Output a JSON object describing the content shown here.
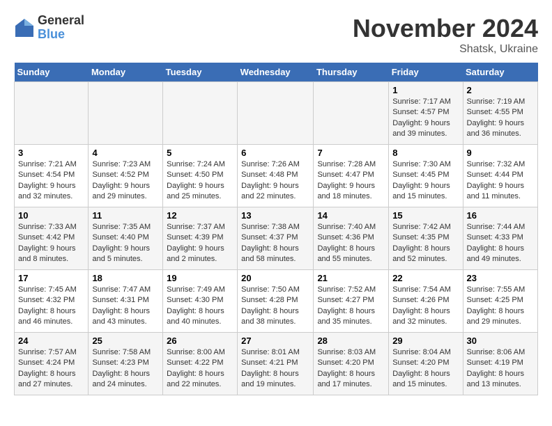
{
  "header": {
    "logo_general": "General",
    "logo_blue": "Blue",
    "month_title": "November 2024",
    "location": "Shatsk, Ukraine"
  },
  "weekdays": [
    "Sunday",
    "Monday",
    "Tuesday",
    "Wednesday",
    "Thursday",
    "Friday",
    "Saturday"
  ],
  "weeks": [
    [
      {
        "day": "",
        "info": ""
      },
      {
        "day": "",
        "info": ""
      },
      {
        "day": "",
        "info": ""
      },
      {
        "day": "",
        "info": ""
      },
      {
        "day": "",
        "info": ""
      },
      {
        "day": "1",
        "info": "Sunrise: 7:17 AM\nSunset: 4:57 PM\nDaylight: 9 hours and 39 minutes."
      },
      {
        "day": "2",
        "info": "Sunrise: 7:19 AM\nSunset: 4:55 PM\nDaylight: 9 hours and 36 minutes."
      }
    ],
    [
      {
        "day": "3",
        "info": "Sunrise: 7:21 AM\nSunset: 4:54 PM\nDaylight: 9 hours and 32 minutes."
      },
      {
        "day": "4",
        "info": "Sunrise: 7:23 AM\nSunset: 4:52 PM\nDaylight: 9 hours and 29 minutes."
      },
      {
        "day": "5",
        "info": "Sunrise: 7:24 AM\nSunset: 4:50 PM\nDaylight: 9 hours and 25 minutes."
      },
      {
        "day": "6",
        "info": "Sunrise: 7:26 AM\nSunset: 4:48 PM\nDaylight: 9 hours and 22 minutes."
      },
      {
        "day": "7",
        "info": "Sunrise: 7:28 AM\nSunset: 4:47 PM\nDaylight: 9 hours and 18 minutes."
      },
      {
        "day": "8",
        "info": "Sunrise: 7:30 AM\nSunset: 4:45 PM\nDaylight: 9 hours and 15 minutes."
      },
      {
        "day": "9",
        "info": "Sunrise: 7:32 AM\nSunset: 4:44 PM\nDaylight: 9 hours and 11 minutes."
      }
    ],
    [
      {
        "day": "10",
        "info": "Sunrise: 7:33 AM\nSunset: 4:42 PM\nDaylight: 9 hours and 8 minutes."
      },
      {
        "day": "11",
        "info": "Sunrise: 7:35 AM\nSunset: 4:40 PM\nDaylight: 9 hours and 5 minutes."
      },
      {
        "day": "12",
        "info": "Sunrise: 7:37 AM\nSunset: 4:39 PM\nDaylight: 9 hours and 2 minutes."
      },
      {
        "day": "13",
        "info": "Sunrise: 7:38 AM\nSunset: 4:37 PM\nDaylight: 8 hours and 58 minutes."
      },
      {
        "day": "14",
        "info": "Sunrise: 7:40 AM\nSunset: 4:36 PM\nDaylight: 8 hours and 55 minutes."
      },
      {
        "day": "15",
        "info": "Sunrise: 7:42 AM\nSunset: 4:35 PM\nDaylight: 8 hours and 52 minutes."
      },
      {
        "day": "16",
        "info": "Sunrise: 7:44 AM\nSunset: 4:33 PM\nDaylight: 8 hours and 49 minutes."
      }
    ],
    [
      {
        "day": "17",
        "info": "Sunrise: 7:45 AM\nSunset: 4:32 PM\nDaylight: 8 hours and 46 minutes."
      },
      {
        "day": "18",
        "info": "Sunrise: 7:47 AM\nSunset: 4:31 PM\nDaylight: 8 hours and 43 minutes."
      },
      {
        "day": "19",
        "info": "Sunrise: 7:49 AM\nSunset: 4:30 PM\nDaylight: 8 hours and 40 minutes."
      },
      {
        "day": "20",
        "info": "Sunrise: 7:50 AM\nSunset: 4:28 PM\nDaylight: 8 hours and 38 minutes."
      },
      {
        "day": "21",
        "info": "Sunrise: 7:52 AM\nSunset: 4:27 PM\nDaylight: 8 hours and 35 minutes."
      },
      {
        "day": "22",
        "info": "Sunrise: 7:54 AM\nSunset: 4:26 PM\nDaylight: 8 hours and 32 minutes."
      },
      {
        "day": "23",
        "info": "Sunrise: 7:55 AM\nSunset: 4:25 PM\nDaylight: 8 hours and 29 minutes."
      }
    ],
    [
      {
        "day": "24",
        "info": "Sunrise: 7:57 AM\nSunset: 4:24 PM\nDaylight: 8 hours and 27 minutes."
      },
      {
        "day": "25",
        "info": "Sunrise: 7:58 AM\nSunset: 4:23 PM\nDaylight: 8 hours and 24 minutes."
      },
      {
        "day": "26",
        "info": "Sunrise: 8:00 AM\nSunset: 4:22 PM\nDaylight: 8 hours and 22 minutes."
      },
      {
        "day": "27",
        "info": "Sunrise: 8:01 AM\nSunset: 4:21 PM\nDaylight: 8 hours and 19 minutes."
      },
      {
        "day": "28",
        "info": "Sunrise: 8:03 AM\nSunset: 4:20 PM\nDaylight: 8 hours and 17 minutes."
      },
      {
        "day": "29",
        "info": "Sunrise: 8:04 AM\nSunset: 4:20 PM\nDaylight: 8 hours and 15 minutes."
      },
      {
        "day": "30",
        "info": "Sunrise: 8:06 AM\nSunset: 4:19 PM\nDaylight: 8 hours and 13 minutes."
      }
    ]
  ]
}
